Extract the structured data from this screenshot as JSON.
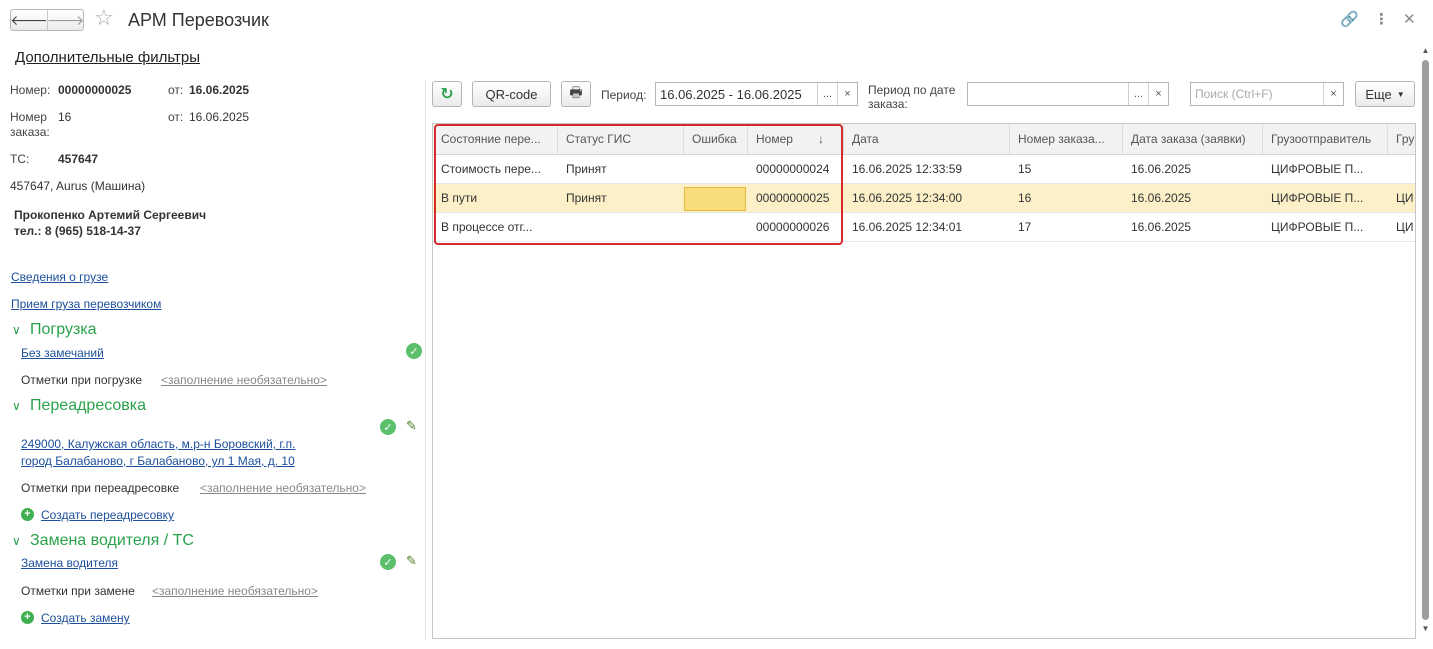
{
  "window": {
    "title": "АРМ Перевозчик",
    "back_icon": "🡐",
    "forward_icon": "🡒"
  },
  "filters_link": "Дополнительные фильтры",
  "details": {
    "number_label": "Номер:",
    "number_value": "00000000025",
    "from_label": "от:",
    "from_value": "16.06.2025",
    "order_label": "Номер заказа:",
    "order_value": "16",
    "order_from_label": "от:",
    "order_from_value": "16.06.2025",
    "ts_label": "ТС:",
    "ts_value": "457647",
    "vehicle": "457647, Aurus (Машина)",
    "driver": "Прокопенко Артемий Сергеевич",
    "phone": "тел.: 8 (965) 518-14-37"
  },
  "links": {
    "cargo_info": "Сведения о грузе",
    "cargo_accept": "Прием груза перевозчиком"
  },
  "sections": {
    "loading": {
      "title": "Погрузка",
      "status_link": "Без замечаний",
      "notes_label": "Отметки при погрузке",
      "notes_placeholder": "<заполнение необязательно>"
    },
    "readdress": {
      "title": "Переадресовка",
      "address_line1": "249000, Калужская область, м.р-н Боровский, г.п.",
      "address_line2": "город Балабаново, г Балабаново, ул 1 Мая, д. 10",
      "notes_label": "Отметки при переадресовке",
      "notes_placeholder": "<заполнение необязательно>",
      "create_link": "Создать переадресовку"
    },
    "driver_change": {
      "title": "Замена водителя / ТС",
      "status_link": "Замена водителя",
      "notes_label": "Отметки при замене",
      "notes_placeholder": "<заполнение необязательно>",
      "create_link": "Создать замену"
    }
  },
  "toolbar": {
    "qr_label": "QR-code",
    "period_label": "Период:",
    "period_value": "16.06.2025 - 16.06.2025",
    "period_by_order_label_1": "Период по дате",
    "period_by_order_label_2": "заказа:",
    "period_by_order_value": "",
    "search_placeholder": "Поиск (Ctrl+F)",
    "more_label": "Еще",
    "dots": "...",
    "clear": "×"
  },
  "table": {
    "columns": [
      "Состояние пере...",
      "Статус ГИС",
      "Ошибка",
      "Номер",
      "Дата",
      "Номер заказа...",
      "Дата заказа (заявки)",
      "Грузоотправитель",
      "Гру"
    ],
    "rows": [
      [
        "Стоимость пере...",
        "Принят",
        "",
        "00000000024",
        "16.06.2025 12:33:59",
        "15",
        "16.06.2025",
        "ЦИФРОВЫЕ П...",
        ""
      ],
      [
        "В пути",
        "Принят",
        "",
        "00000000025",
        "16.06.2025 12:34:00",
        "16",
        "16.06.2025",
        "ЦИФРОВЫЕ П...",
        "ЦИ"
      ],
      [
        "В процессе отг...",
        "",
        "",
        "00000000026",
        "16.06.2025 12:34:01",
        "17",
        "16.06.2025",
        "ЦИФРОВЫЕ П...",
        "ЦИ"
      ]
    ],
    "selected_row": 1,
    "sort_column": "Номер"
  }
}
